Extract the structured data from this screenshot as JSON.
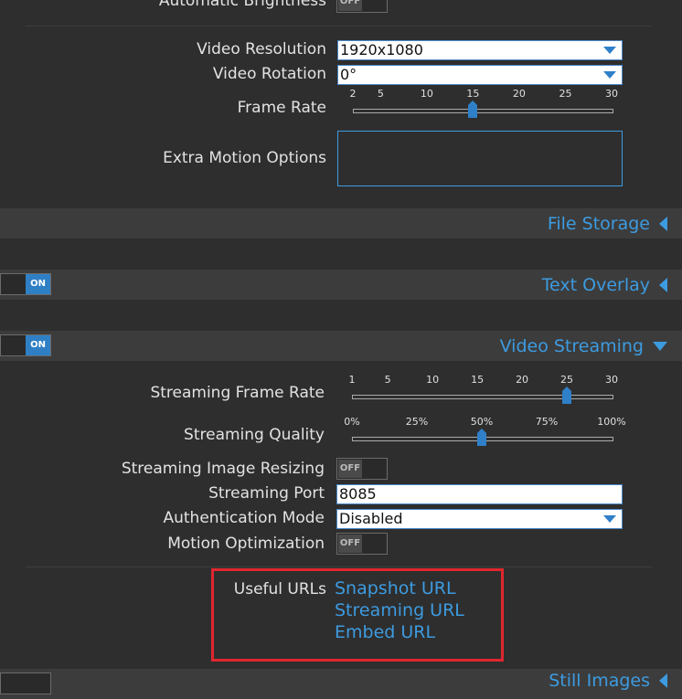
{
  "top": {
    "auto_brightness_label": "Automatic Brightness",
    "auto_brightness_toggle": "OFF"
  },
  "video": {
    "resolution_label": "Video Resolution",
    "resolution_value": "1920x1080",
    "rotation_label": "Video Rotation",
    "rotation_value": "0°",
    "frame_rate_label": "Frame Rate",
    "frame_rate_ticks": [
      "2",
      "5",
      "10",
      "15",
      "20",
      "25",
      "30"
    ],
    "frame_rate_value": 15,
    "extra_motion_label": "Extra Motion Options",
    "extra_motion_value": ""
  },
  "sections": {
    "file_storage": "File Storage",
    "text_overlay": "Text Overlay",
    "text_overlay_toggle": "ON",
    "video_streaming": "Video Streaming",
    "video_streaming_toggle": "ON",
    "still_images": "Still Images"
  },
  "streaming": {
    "frame_rate_label": "Streaming Frame Rate",
    "frame_rate_ticks": [
      "1",
      "5",
      "10",
      "15",
      "20",
      "25",
      "30"
    ],
    "frame_rate_value": 25,
    "quality_label": "Streaming Quality",
    "quality_ticks": [
      "0%",
      "25%",
      "50%",
      "75%",
      "100%"
    ],
    "quality_value": 50,
    "resizing_label": "Streaming Image Resizing",
    "resizing_toggle": "OFF",
    "port_label": "Streaming Port",
    "port_value": "8085",
    "auth_label": "Authentication Mode",
    "auth_value": "Disabled",
    "motion_opt_label": "Motion Optimization",
    "motion_opt_toggle": "OFF"
  },
  "urls": {
    "label": "Useful URLs",
    "snapshot": "Snapshot URL",
    "streaming": "Streaming URL",
    "embed": "Embed URL"
  },
  "colors": {
    "accent": "#3d9be0",
    "highlight": "#e0262f",
    "background": "#2e2e2e"
  }
}
